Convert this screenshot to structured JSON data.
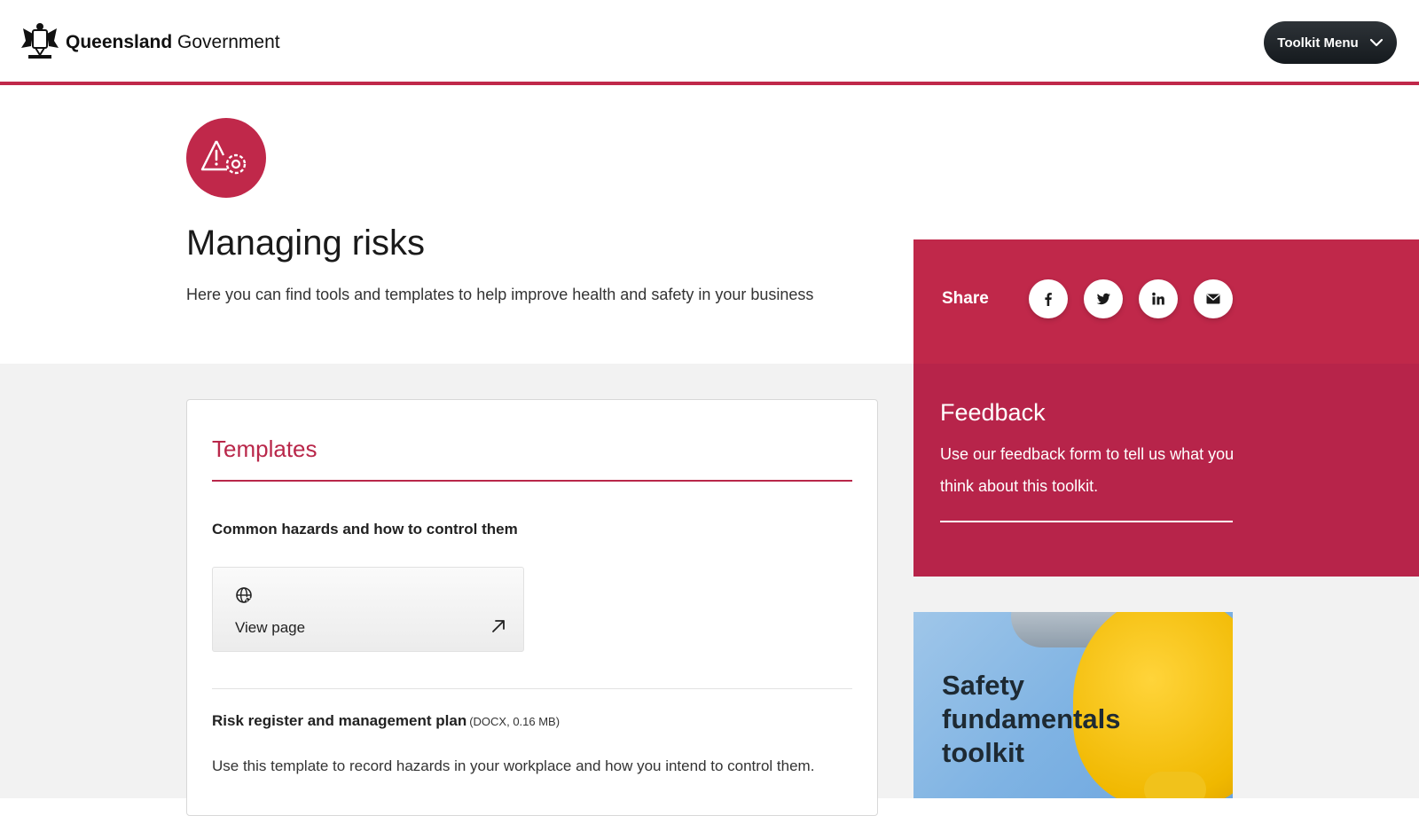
{
  "header": {
    "logo_bold": "Queensland",
    "logo_regular": "Government",
    "toolkit_menu_label": "Toolkit Menu"
  },
  "hero": {
    "title": "Managing risks",
    "subtitle": "Here you can find tools and templates to help improve health and safety in your business"
  },
  "share": {
    "label": "Share",
    "buttons": [
      "facebook-icon",
      "twitter-icon",
      "linkedin-icon",
      "email-icon"
    ]
  },
  "feedback": {
    "title": "Feedback",
    "text": "Use our feedback form to tell us what you think about this toolkit."
  },
  "templates": {
    "title": "Templates",
    "items": [
      {
        "title": "Common hazards and how to control them",
        "link_label": "View page"
      },
      {
        "title": "Risk register and management plan",
        "meta": "(DOCX, 0.16 MB)",
        "description": "Use this template to record hazards in your workplace and how you intend to control them."
      }
    ]
  },
  "promo": {
    "title": "Safety fundamentals toolkit"
  },
  "colors": {
    "brand_red": "#c0284a",
    "dark_button": "#1f2428",
    "grey_band": "#f2f2f2"
  }
}
